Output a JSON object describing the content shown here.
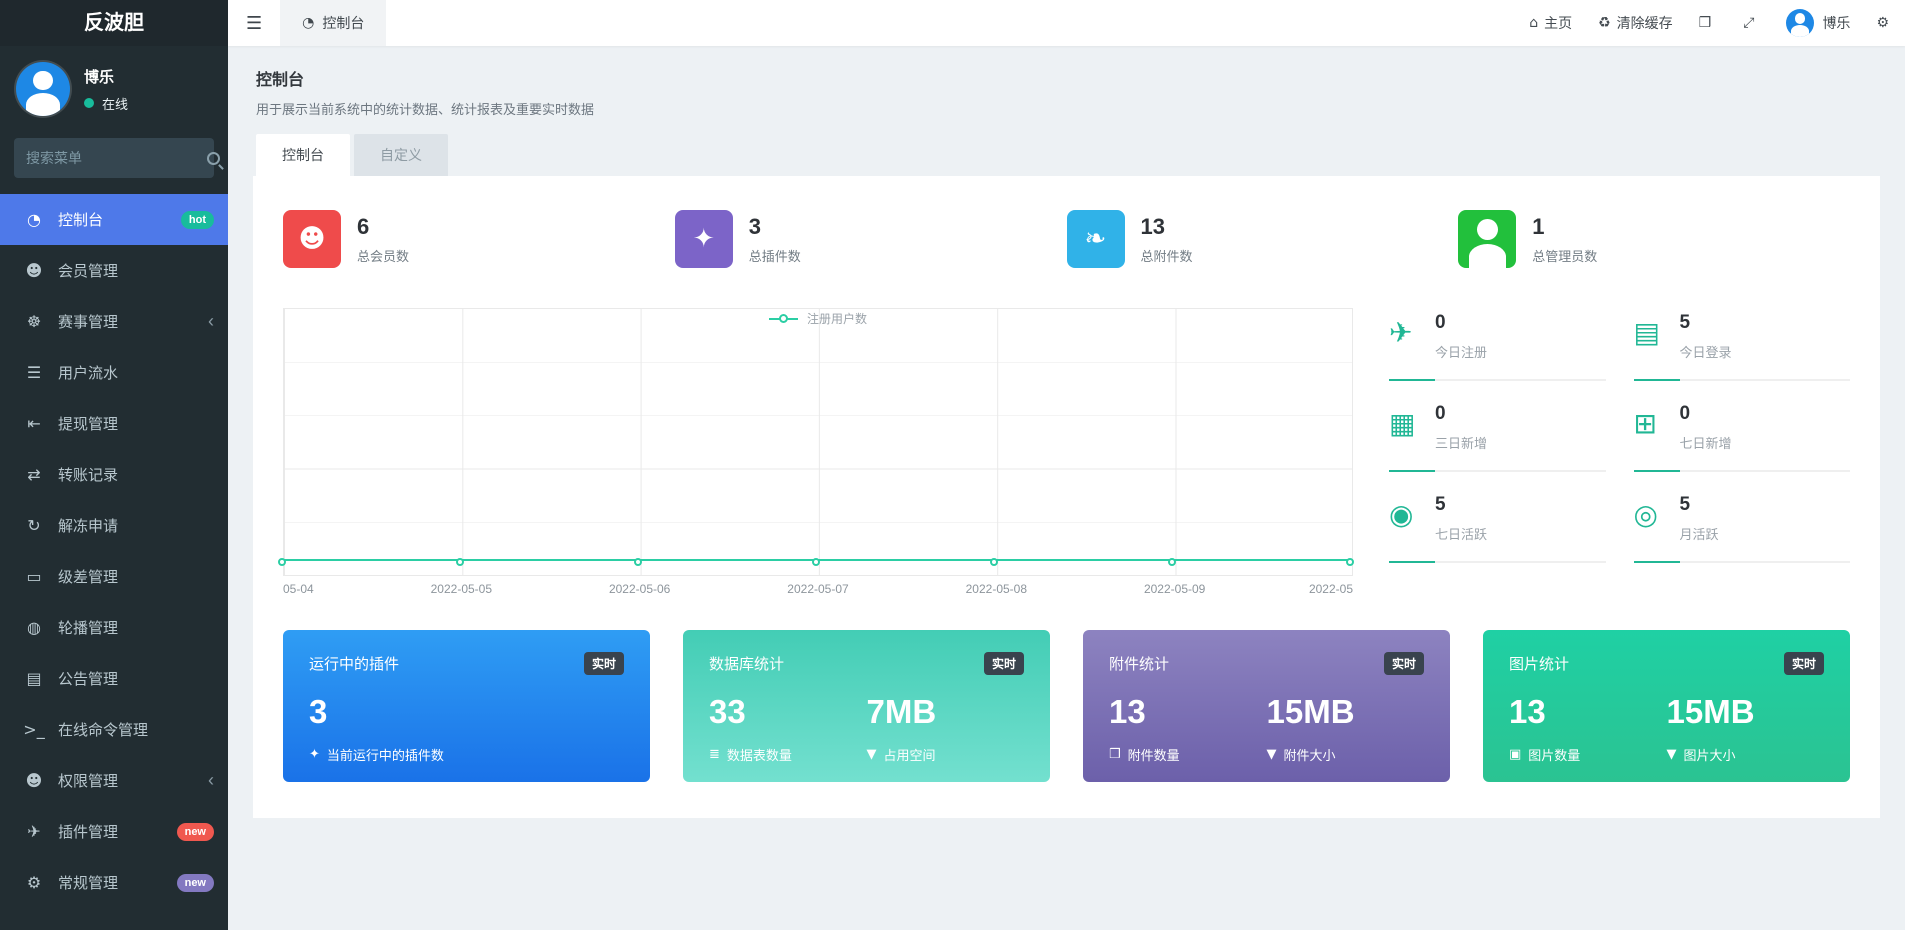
{
  "app": {
    "title": "反波胆"
  },
  "sidebar": {
    "user": {
      "name": "博乐",
      "status": "在线",
      "status_color": "#18bc9c"
    },
    "search_placeholder": "搜索菜单",
    "items": [
      {
        "label": "控制台",
        "icon": "dashboard-icon",
        "active": true,
        "badge": "hot",
        "badge_color": "#18bc9c"
      },
      {
        "label": "会员管理",
        "icon": "users-icon"
      },
      {
        "label": "赛事管理",
        "icon": "matches-icon",
        "chevron": true
      },
      {
        "label": "用户流水",
        "icon": "list-icon"
      },
      {
        "label": "提现管理",
        "icon": "withdraw-icon"
      },
      {
        "label": "转账记录",
        "icon": "transfer-icon"
      },
      {
        "label": "解冻申请",
        "icon": "unfreeze-icon"
      },
      {
        "label": "级差管理",
        "icon": "level-icon"
      },
      {
        "label": "轮播管理",
        "icon": "carousel-icon"
      },
      {
        "label": "公告管理",
        "icon": "notice-icon"
      },
      {
        "label": "在线命令管理",
        "icon": "terminal-icon"
      },
      {
        "label": "权限管理",
        "icon": "auth-icon",
        "chevron": true
      },
      {
        "label": "插件管理",
        "icon": "addon-rocket-icon",
        "badge": "new",
        "badge_color": "#f0584f"
      },
      {
        "label": "常规管理",
        "icon": "cogs-icon",
        "badge": "new",
        "badge_color": "#8379c1"
      }
    ]
  },
  "navbar": {
    "tab_label": "控制台",
    "home_label": "主页",
    "clear_cache_label": "清除缓存",
    "user_name": "博乐"
  },
  "page": {
    "title": "控制台",
    "subtitle": "用于展示当前系统中的统计数据、统计报表及重要实时数据",
    "tabs": [
      {
        "label": "控制台",
        "active": true
      },
      {
        "label": "自定义",
        "active": false
      }
    ]
  },
  "stats": [
    {
      "value": "6",
      "label": "总会员数",
      "icon": "users-icon",
      "color": "#ef4b4b"
    },
    {
      "value": "3",
      "label": "总插件数",
      "icon": "magic-icon",
      "color": "#7c64c8"
    },
    {
      "value": "13",
      "label": "总附件数",
      "icon": "leaf-icon",
      "color": "#30b2e8"
    },
    {
      "value": "1",
      "label": "总管理员数",
      "icon": "person-icon",
      "color": "#22c03c"
    }
  ],
  "chart_data": {
    "type": "line",
    "series": [
      {
        "name": "注册用户数",
        "values": [
          0,
          0,
          0,
          0,
          0,
          0,
          0
        ]
      }
    ],
    "x_tick_labels": [
      "05-04",
      "2022-05-05",
      "2022-05-06",
      "2022-05-07",
      "2022-05-08",
      "2022-05-09",
      "2022-05"
    ],
    "title": "",
    "xlabel": "",
    "ylabel": "",
    "y_tick_labels_visible": false,
    "line_color": "#2bcea4",
    "grid": true,
    "legend_position": "top-center"
  },
  "mini_stats": [
    {
      "value": "0",
      "label": "今日注册",
      "icon": "rocket-icon"
    },
    {
      "value": "5",
      "label": "今日登录",
      "icon": "idcard-icon"
    },
    {
      "value": "0",
      "label": "三日新增",
      "icon": "calendar-icon"
    },
    {
      "value": "0",
      "label": "七日新增",
      "icon": "calendar-plus-icon"
    },
    {
      "value": "5",
      "label": "七日活跃",
      "icon": "user-circle-icon"
    },
    {
      "value": "5",
      "label": "月活跃",
      "icon": "user-circle-o-icon"
    }
  ],
  "cards": [
    {
      "title": "运行中的插件",
      "badge": "实时",
      "gradient": [
        "#2f9df4",
        "#1a72e8"
      ],
      "cols": [
        {
          "value": "3",
          "icon": "magic-icon",
          "label": "当前运行中的插件数"
        }
      ]
    },
    {
      "title": "数据库统计",
      "badge": "实时",
      "gradient": [
        "#43cdb5",
        "#73e0cf"
      ],
      "cols": [
        {
          "value": "33",
          "icon": "database-icon",
          "label": "数据表数量"
        },
        {
          "value": "7MB",
          "icon": "filter-icon",
          "label": "占用空间"
        }
      ]
    },
    {
      "title": "附件统计",
      "badge": "实时",
      "gradient": [
        "#8d83c0",
        "#6c60aa"
      ],
      "cols": [
        {
          "value": "13",
          "icon": "clone-icon",
          "label": "附件数量"
        },
        {
          "value": "15MB",
          "icon": "filter-icon",
          "label": "附件大小"
        }
      ]
    },
    {
      "title": "图片统计",
      "badge": "实时",
      "gradient": [
        "#1fd0a4",
        "#2bc392"
      ],
      "cols": [
        {
          "value": "13",
          "icon": "image-icon",
          "label": "图片数量"
        },
        {
          "value": "15MB",
          "icon": "filter-icon",
          "label": "图片大小"
        }
      ]
    }
  ]
}
